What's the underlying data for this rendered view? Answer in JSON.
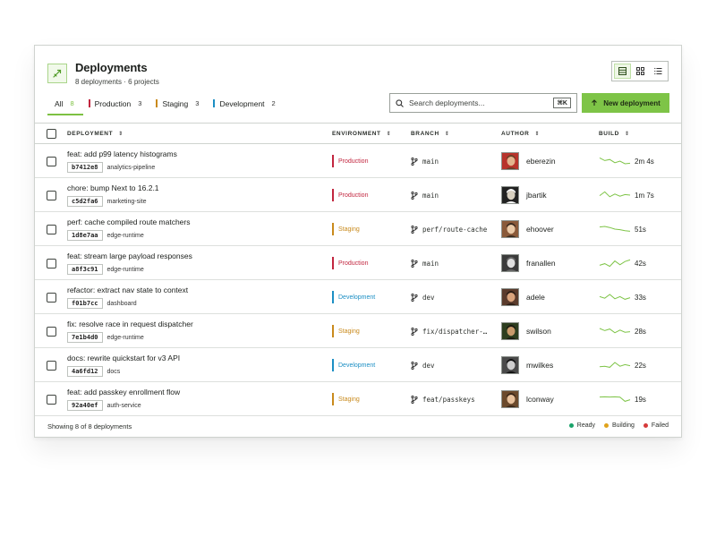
{
  "header": {
    "title": "Deployments",
    "subtitle": "8 deployments · 6 projects"
  },
  "view_toggle": {
    "active": "table"
  },
  "tabs": [
    {
      "label": "All",
      "count": "8",
      "color": "",
      "active": true
    },
    {
      "label": "Production",
      "count": "3",
      "color": "#c2263f"
    },
    {
      "label": "Staging",
      "count": "3",
      "color": "#c98a1c"
    },
    {
      "label": "Development",
      "count": "2",
      "color": "#1c8fc4"
    }
  ],
  "search": {
    "placeholder": "Search deployments...",
    "shortcut": "⌘K"
  },
  "new_button": {
    "label": "New deployment"
  },
  "columns": {
    "deployment": "DEPLOYMENT",
    "environment": "ENVIRONMENT",
    "branch": "BRANCH",
    "author": "AUTHOR",
    "build": "BUILD"
  },
  "env_colors": {
    "Production": "#c2263f",
    "Staging": "#c98a1c",
    "Development": "#1c8fc4"
  },
  "rows": [
    {
      "message": "feat: add p99 latency histograms",
      "sha": "b7412e8",
      "project": "analytics-pipeline",
      "environment": "Production",
      "branch": "main",
      "author": "eberezin",
      "build": "2m 4s",
      "spark": [
        0.8,
        0.55,
        0.65,
        0.35,
        0.5,
        0.25,
        0.3
      ]
    },
    {
      "message": "chore: bump Next to 16.2.1",
      "sha": "c5d2fa6",
      "project": "marketing-site",
      "environment": "Production",
      "branch": "main",
      "author": "jbartik",
      "build": "1m 7s",
      "spark": [
        0.45,
        0.8,
        0.35,
        0.6,
        0.4,
        0.55,
        0.5
      ]
    },
    {
      "message": "perf: cache compiled route matchers",
      "sha": "1d8e7aa",
      "project": "edge-runtime",
      "environment": "Staging",
      "branch": "perf/route-cache",
      "author": "ehoover",
      "build": "51s",
      "spark": [
        0.7,
        0.75,
        0.65,
        0.5,
        0.45,
        0.35,
        0.3
      ]
    },
    {
      "message": "feat: stream large payload responses",
      "sha": "a8f3c91",
      "project": "edge-runtime",
      "environment": "Production",
      "branch": "main",
      "author": "franallen",
      "build": "42s",
      "spark": [
        0.3,
        0.45,
        0.2,
        0.7,
        0.35,
        0.65,
        0.8
      ]
    },
    {
      "message": "refactor: extract nav state to context",
      "sha": "f01b7cc",
      "project": "dashboard",
      "environment": "Development",
      "branch": "dev",
      "author": "adele",
      "build": "33s",
      "spark": [
        0.55,
        0.4,
        0.75,
        0.35,
        0.55,
        0.3,
        0.45
      ]
    },
    {
      "message": "fix: resolve race in request dispatcher",
      "sha": "7e1b4d0",
      "project": "edge-runtime",
      "environment": "Staging",
      "branch": "fix/dispatcher-…",
      "author": "swilson",
      "build": "28s",
      "spark": [
        0.75,
        0.55,
        0.7,
        0.35,
        0.6,
        0.4,
        0.45
      ]
    },
    {
      "message": "docs: rewrite quickstart for v3 API",
      "sha": "4a6fd12",
      "project": "docs",
      "environment": "Development",
      "branch": "dev",
      "author": "mwilkes",
      "build": "22s",
      "spark": [
        0.35,
        0.4,
        0.3,
        0.75,
        0.4,
        0.55,
        0.45
      ]
    },
    {
      "message": "feat: add passkey enrollment flow",
      "sha": "92a40ef",
      "project": "auth-service",
      "environment": "Staging",
      "branch": "feat/passkeys",
      "author": "lconway",
      "build": "19s",
      "spark": [
        0.7,
        0.72,
        0.7,
        0.72,
        0.68,
        0.3,
        0.45
      ]
    }
  ],
  "footer": {
    "summary": "Showing 8 of 8 deployments"
  },
  "legend": [
    {
      "label": "Ready",
      "color": "#1aa36a"
    },
    {
      "label": "Building",
      "color": "#e0a31c"
    },
    {
      "label": "Failed",
      "color": "#d63a3a"
    }
  ],
  "accent_color": "#7ec447"
}
